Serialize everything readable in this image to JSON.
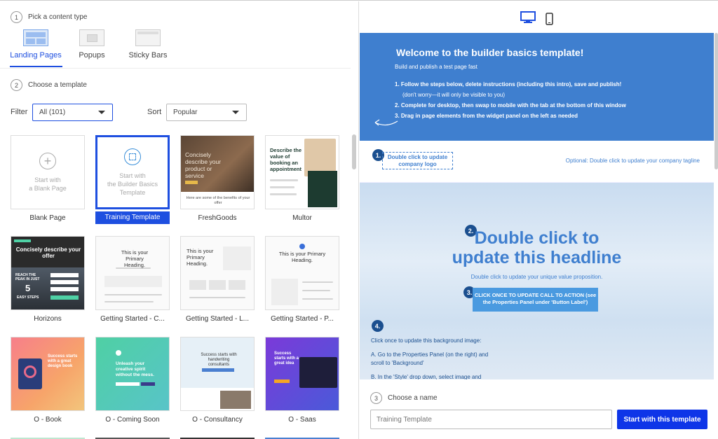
{
  "step1": {
    "num": "1",
    "label": "Pick a content type"
  },
  "content_types": [
    {
      "label": "Landing Pages",
      "active": true
    },
    {
      "label": "Popups",
      "active": false
    },
    {
      "label": "Sticky Bars",
      "active": false
    }
  ],
  "step2": {
    "num": "2",
    "label": "Choose a template"
  },
  "filter": {
    "label": "Filter",
    "value": "All (101)"
  },
  "sort": {
    "label": "Sort",
    "value": "Popular"
  },
  "templates": [
    {
      "name": "Blank Page",
      "thumb_line1": "Start with",
      "thumb_line2": "a Blank Page"
    },
    {
      "name": "Training Template",
      "thumb_line1": "Start with",
      "thumb_line2": "the Builder Basics",
      "thumb_line3": "Template"
    },
    {
      "name": "FreshGoods",
      "thumb_text": "Concisely describe your product or service",
      "thumb_footer": "Here are some of the benefits of your offer"
    },
    {
      "name": "Multor",
      "thumb_text": "Describe the value of booking an appointment"
    },
    {
      "name": "Horizons",
      "thumb_text": "Concisely describe your offer",
      "thumb_sub": "REACH THE PEAK IN JUST",
      "thumb_num": "5",
      "thumb_steps": "EASY STEPS"
    },
    {
      "name": "Getting Started - C...",
      "thumb_text": "This is your Primary Heading."
    },
    {
      "name": "Getting Started - L...",
      "thumb_text": "This is your Primary Heading."
    },
    {
      "name": "Getting Started - P...",
      "thumb_text": "This is your Primary Heading."
    },
    {
      "name": "O - Book",
      "thumb_text": "Success starts with a great design book"
    },
    {
      "name": "O - Coming Soon",
      "thumb_text": "Unleash your creative spirit without the mess."
    },
    {
      "name": "O - Consultancy",
      "thumb_text": "Success starts with handwriting consultants"
    },
    {
      "name": "O - Saas",
      "thumb_text": "Success starts with a great idea"
    }
  ],
  "preview": {
    "title": "Welcome to the builder basics template!",
    "subtitle": "Build and publish a test page fast",
    "steps": [
      {
        "n": "1.",
        "pre": "Follow the steps below, delete instructions (including this intro), save and publish!"
      },
      {
        "n": "",
        "pre": "(don't worry—it will only be visible to you)"
      },
      {
        "n": "2.",
        "pre": "Complete for desktop, then swap to mobile with the tab at the bottom of this window"
      },
      {
        "n": "3.",
        "pre": "Drag in page elements from the widget panel on the left as needed"
      }
    ],
    "badge1": "1.",
    "logo_text": "Double click to update company logo",
    "tagline": "Optional: Double click to update your company tagline",
    "badge2": "2.",
    "headline": "Double click to update this headline",
    "uvp": "Double click to update your unique value proposition.",
    "badge3": "3.",
    "cta": "CLICK ONCE TO UPDATE CALL TO ACTION  (see the Properties Panel under 'Button Label')",
    "badge4": "4.",
    "inst1": "Click once to update this background image:",
    "inst2": "A. Go to the Properties Panel (on the right) and",
    "inst3": "scroll to 'Background'",
    "inst4": "B. In the 'Style' drop down, select image and"
  },
  "step3": {
    "num": "3",
    "label": "Choose a name"
  },
  "name_input": {
    "value": "Training Template"
  },
  "start_button": "Start with this template",
  "colors": {
    "accent": "#1e4fe0",
    "preview_blue": "#3f7fcf",
    "cta_button": "#0e35e8"
  }
}
